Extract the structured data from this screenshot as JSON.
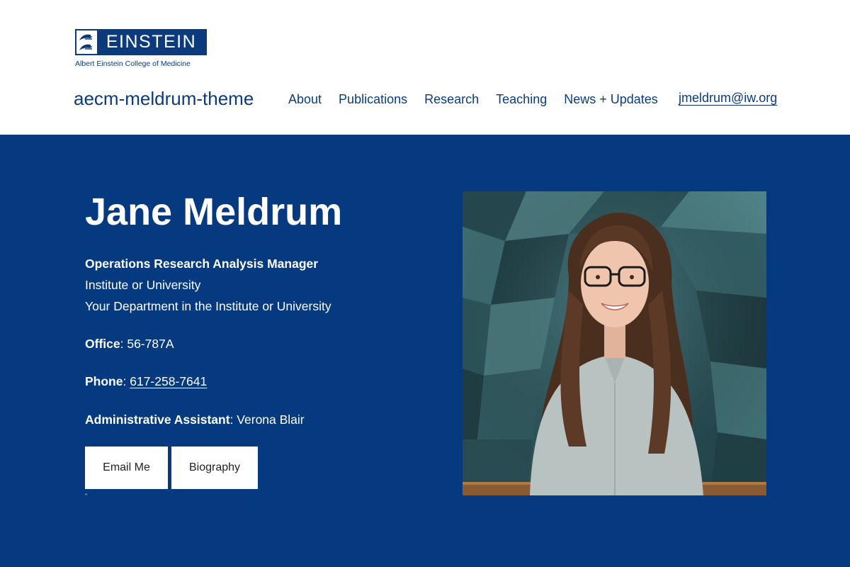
{
  "logo": {
    "word": "EINSTEIN",
    "subtitle": "Albert Einstein College of Medicine"
  },
  "site": {
    "title": "aecm-meldrum-theme"
  },
  "nav": {
    "items": [
      "About",
      "Publications",
      "Research",
      "Teaching",
      "News + Updates"
    ],
    "email": "jmeldrum@iw.org"
  },
  "profile": {
    "name": "Jane Meldrum",
    "role": "Operations Research Analysis Manager",
    "institution": "Institute or University",
    "department": "Your Department in the Institute or University",
    "office_label": "Office",
    "office_value": "56-787A",
    "phone_label": "Phone",
    "phone_value": "617-258-7641",
    "assistant_label": "Administrative Assistant",
    "assistant_value": "Verona Blair"
  },
  "buttons": {
    "email": "Email Me",
    "bio": "Biography"
  },
  "stray_mark": "\"",
  "colors": {
    "brand": "#0b3b7d",
    "hero_bg": "#053a80",
    "text_on_dark": "#ffffff"
  },
  "icons": {
    "logo_mark": "einstein-logo-mark-icon"
  }
}
